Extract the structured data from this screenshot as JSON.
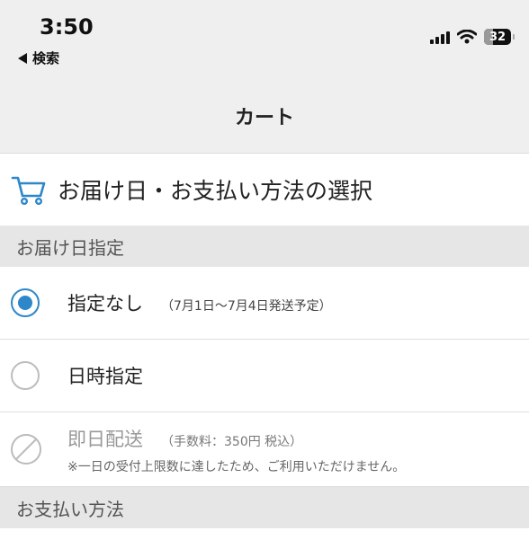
{
  "status_bar": {
    "time": "3:50",
    "back_label": "検索",
    "battery": "32",
    "icons": [
      "signal-icon",
      "wifi-icon",
      "battery-icon"
    ]
  },
  "nav": {
    "title": "カート"
  },
  "page": {
    "heading": "お届け日・お支払い方法の選択",
    "heading_icon": "cart-icon"
  },
  "delivery": {
    "header": "お届け日指定",
    "options": [
      {
        "label": "指定なし",
        "note": "（7月1日〜7月4日発送予定）",
        "state": "selected"
      },
      {
        "label": "日時指定",
        "note": "",
        "state": "unselected"
      },
      {
        "label": "即日配送",
        "note": "（手数料：350円 税込）",
        "warning": "※一日の受付上限数に達したため、ご利用いただけません。",
        "state": "disabled"
      }
    ]
  },
  "payment": {
    "header": "お支払い方法"
  },
  "colors": {
    "accent": "#2d87c9",
    "header_bg": "#efefef",
    "group_bg": "#e6e6e6"
  }
}
